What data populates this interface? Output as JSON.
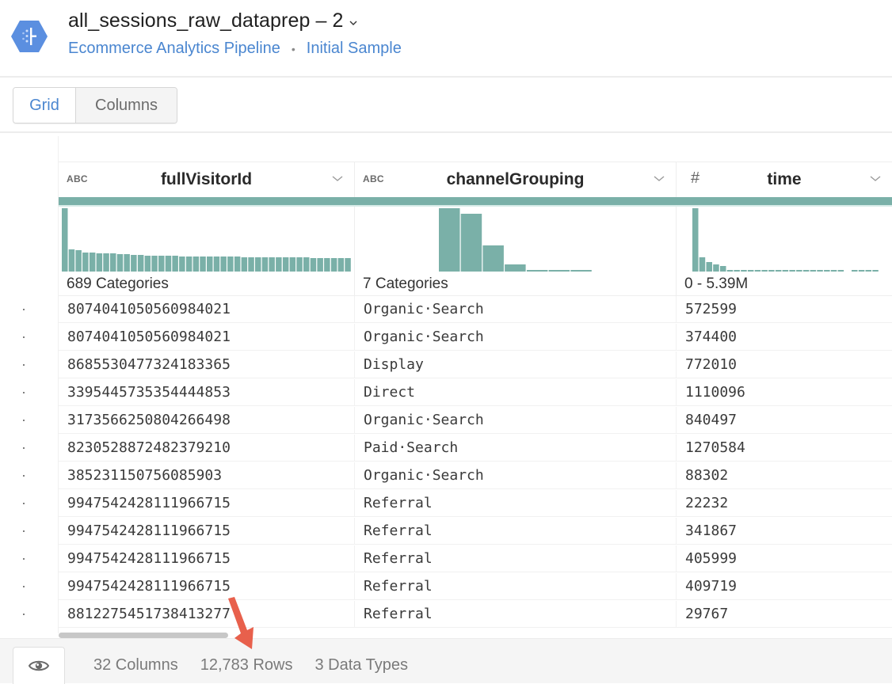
{
  "header": {
    "title": "all_sessions_raw_dataprep – 2",
    "breadcrumb": [
      "Ecommerce Analytics Pipeline",
      "Initial Sample"
    ],
    "breadcrumb_separator": "•",
    "brand_color": "#4a86d0"
  },
  "toolbar": {
    "tabs": [
      {
        "label": "Grid",
        "active": true
      },
      {
        "label": "Columns",
        "active": false
      }
    ]
  },
  "grid": {
    "accent_color": "#7ab0a8",
    "columns": [
      {
        "name": "fullVisitorId",
        "type_icon": "ABC",
        "summary": "689 Categories",
        "histogram": [
          80,
          28,
          27,
          24,
          24,
          23,
          23,
          23,
          22,
          22,
          21,
          21,
          20,
          20,
          20,
          20,
          20,
          19,
          19,
          19,
          19,
          19,
          19,
          19,
          19,
          19,
          18,
          18,
          18,
          18,
          18,
          18,
          18,
          18,
          18,
          18,
          17,
          17,
          17,
          17,
          17,
          17
        ]
      },
      {
        "name": "channelGrouping",
        "type_icon": "#ABC",
        "summary": "7 Categories",
        "histogram": [
          80,
          73,
          33,
          9,
          2,
          2,
          2
        ]
      },
      {
        "name": "time",
        "type_icon": "#",
        "summary": "0 - 5.39M",
        "histogram": [
          80,
          18,
          12,
          9,
          7,
          2,
          2,
          2,
          2,
          2,
          2,
          2,
          2,
          2,
          2,
          2,
          2,
          2,
          2,
          2,
          2,
          2,
          0,
          2,
          2,
          2,
          2
        ]
      }
    ],
    "rows": [
      [
        "8074041050560984021",
        "Organic·Search",
        "572599"
      ],
      [
        "8074041050560984021",
        "Organic·Search",
        "374400"
      ],
      [
        "8685530477324183365",
        "Display",
        "772010"
      ],
      [
        "3395445735354444853",
        "Direct",
        "1110096"
      ],
      [
        "3173566250804266498",
        "Organic·Search",
        "840497"
      ],
      [
        "8230528872482379210",
        "Paid·Search",
        "1270584"
      ],
      [
        "385231150756085903",
        "Organic·Search",
        "88302"
      ],
      [
        "9947542428111966715",
        "Referral",
        "22232"
      ],
      [
        "9947542428111966715",
        "Referral",
        "341867"
      ],
      [
        "9947542428111966715",
        "Referral",
        "405999"
      ],
      [
        "9947542428111966715",
        "Referral",
        "409719"
      ],
      [
        "8812275451738413277",
        "Referral",
        "29767"
      ]
    ]
  },
  "footer": {
    "columns": "32 Columns",
    "rows": "12,783 Rows",
    "data_types": "3 Data Types"
  },
  "annotation": {
    "arrow_color": "#e8604c"
  }
}
